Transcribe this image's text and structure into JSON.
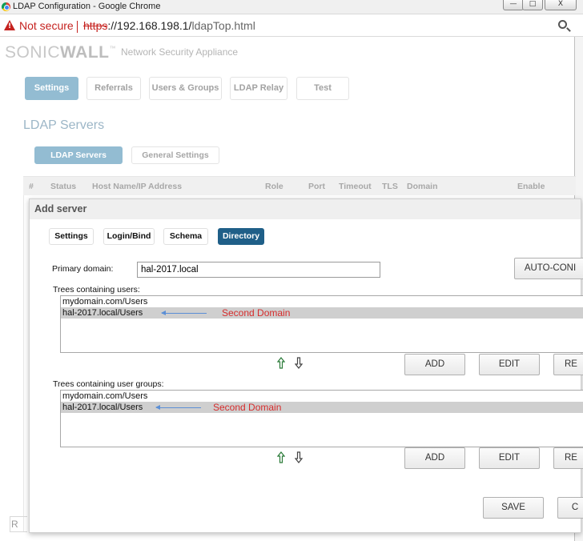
{
  "window": {
    "title": "LDAP Configuration - Google Chrome",
    "min": "—",
    "max": "□",
    "close": "X"
  },
  "address": {
    "security": "Not secure",
    "scheme": "https",
    "host": "://192.168.198.1/",
    "path": "ldapTop.html"
  },
  "brand": {
    "name_light": "SONIC",
    "name_bold": "WALL",
    "tm": "™",
    "tagline": "Network Security Appliance"
  },
  "top_tabs": [
    "Settings",
    "Referrals",
    "Users & Groups",
    "LDAP Relay",
    "Test"
  ],
  "section_title": "LDAP Servers",
  "sub_tabs": [
    "LDAP Servers",
    "General Settings"
  ],
  "columns": [
    "#",
    "Status",
    "Host Name/IP Address",
    "Role",
    "Port",
    "Timeout",
    "TLS",
    "Domain",
    "Enable"
  ],
  "dialog": {
    "title": "Add server",
    "tabs": [
      "Settings",
      "Login/Bind",
      "Schema",
      "Directory"
    ],
    "primary_domain_label": "Primary domain:",
    "primary_domain_value": "hal-2017.local",
    "auto_config": "AUTO-CONI",
    "user_trees_label": "Trees containing users:",
    "user_trees": [
      "mydomain.com/Users",
      "hal-2017.local/Users"
    ],
    "group_trees_label": "Trees containing user groups:",
    "group_trees": [
      "mydomain.com/Users",
      "hal-2017.local/Users"
    ],
    "annotation": "Second Domain",
    "add": "ADD",
    "edit": "EDIT",
    "remove": "RE",
    "save": "SAVE",
    "cancel": "C"
  },
  "bottom_cut": "R",
  "colors": {
    "accent": "#93bcd2",
    "active_tab": "#1f5f88",
    "warning": "#c5221f",
    "annotation": "#d62c2c",
    "arrow": "#5b8fd6"
  }
}
